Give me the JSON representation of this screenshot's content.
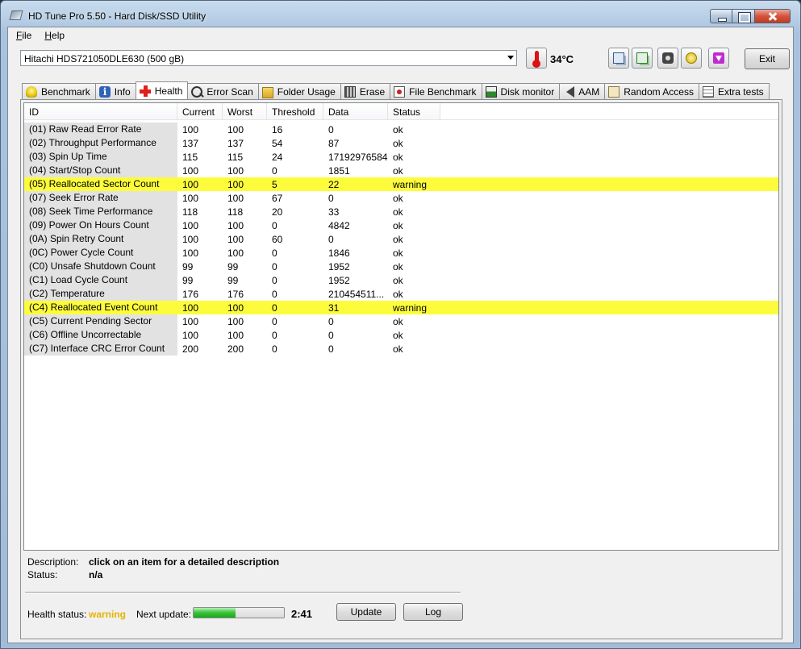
{
  "window": {
    "title": "HD Tune Pro 5.50 - Hard Disk/SSD Utility"
  },
  "menu": [
    "File",
    "Help"
  ],
  "toolbar": {
    "drive": "Hitachi HDS721050DLE630 (500 gB)",
    "temperature": "34°C",
    "icons": [
      "copy-text-icon",
      "copy-screenshot-icon",
      "camera-icon",
      "options-icon",
      "download-icon"
    ],
    "exit_label": "Exit"
  },
  "tabs": [
    {
      "label": "Benchmark",
      "icon": "bulb-icon"
    },
    {
      "label": "Info",
      "icon": "info-icon"
    },
    {
      "label": "Health",
      "icon": "health-cross-icon",
      "active": true
    },
    {
      "label": "Error Scan",
      "icon": "magnifier-icon"
    },
    {
      "label": "Folder Usage",
      "icon": "folder-icon"
    },
    {
      "label": "Erase",
      "icon": "erase-icon"
    },
    {
      "label": "File Benchmark",
      "icon": "file-benchmark-icon"
    },
    {
      "label": "Disk monitor",
      "icon": "disk-monitor-icon"
    },
    {
      "label": "AAM",
      "icon": "speaker-icon"
    },
    {
      "label": "Random Access",
      "icon": "random-access-icon"
    },
    {
      "label": "Extra tests",
      "icon": "extra-tests-icon"
    }
  ],
  "table": {
    "columns": [
      "ID",
      "Current",
      "Worst",
      "Threshold",
      "Data",
      "Status"
    ],
    "rows": [
      {
        "id": "(01) Raw Read Error Rate",
        "current": "100",
        "worst": "100",
        "threshold": "16",
        "data": "0",
        "status": "ok"
      },
      {
        "id": "(02) Throughput Performance",
        "current": "137",
        "worst": "137",
        "threshold": "54",
        "data": "87",
        "status": "ok"
      },
      {
        "id": "(03) Spin Up Time",
        "current": "115",
        "worst": "115",
        "threshold": "24",
        "data": "17192976584",
        "status": "ok"
      },
      {
        "id": "(04) Start/Stop Count",
        "current": "100",
        "worst": "100",
        "threshold": "0",
        "data": "1851",
        "status": "ok"
      },
      {
        "id": "(05) Reallocated Sector Count",
        "current": "100",
        "worst": "100",
        "threshold": "5",
        "data": "22",
        "status": "warning"
      },
      {
        "id": "(07) Seek Error Rate",
        "current": "100",
        "worst": "100",
        "threshold": "67",
        "data": "0",
        "status": "ok"
      },
      {
        "id": "(08) Seek Time Performance",
        "current": "118",
        "worst": "118",
        "threshold": "20",
        "data": "33",
        "status": "ok"
      },
      {
        "id": "(09) Power On Hours Count",
        "current": "100",
        "worst": "100",
        "threshold": "0",
        "data": "4842",
        "status": "ok"
      },
      {
        "id": "(0A) Spin Retry Count",
        "current": "100",
        "worst": "100",
        "threshold": "60",
        "data": "0",
        "status": "ok"
      },
      {
        "id": "(0C) Power Cycle Count",
        "current": "100",
        "worst": "100",
        "threshold": "0",
        "data": "1846",
        "status": "ok"
      },
      {
        "id": "(C0) Unsafe Shutdown Count",
        "current": "99",
        "worst": "99",
        "threshold": "0",
        "data": "1952",
        "status": "ok"
      },
      {
        "id": "(C1) Load Cycle Count",
        "current": "99",
        "worst": "99",
        "threshold": "0",
        "data": "1952",
        "status": "ok"
      },
      {
        "id": "(C2) Temperature",
        "current": "176",
        "worst": "176",
        "threshold": "0",
        "data": "210454511...",
        "status": "ok"
      },
      {
        "id": "(C4) Reallocated Event Count",
        "current": "100",
        "worst": "100",
        "threshold": "0",
        "data": "31",
        "status": "warning"
      },
      {
        "id": "(C5) Current Pending Sector",
        "current": "100",
        "worst": "100",
        "threshold": "0",
        "data": "0",
        "status": "ok"
      },
      {
        "id": "(C6) Offline Uncorrectable",
        "current": "100",
        "worst": "100",
        "threshold": "0",
        "data": "0",
        "status": "ok"
      },
      {
        "id": "(C7) Interface CRC Error Count",
        "current": "200",
        "worst": "200",
        "threshold": "0",
        "data": "0",
        "status": "ok"
      }
    ]
  },
  "description": {
    "label": "Description:",
    "value": "click on an item for a detailed description",
    "status_label": "Status:",
    "status_value": "n/a"
  },
  "footer": {
    "health_label": "Health status:",
    "health_value": "warning",
    "next_update_label": "Next update:",
    "next_update_progress": 0.46,
    "next_update_time": "2:41",
    "update_label": "Update",
    "log_label": "Log"
  },
  "colors": {
    "warning_row": "#fcfc3c",
    "warning_text": "#e5b300",
    "progress_green": "#37c437"
  }
}
